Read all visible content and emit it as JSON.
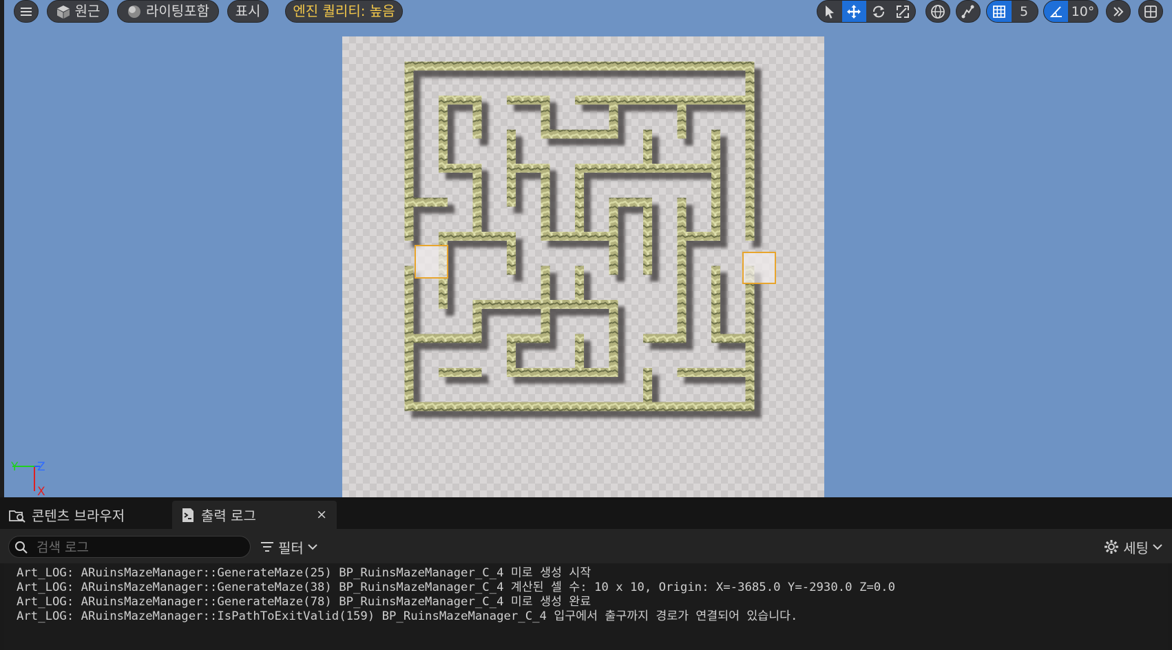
{
  "viewport": {
    "menu_icon": "hamburger-icon",
    "perspective_label": "원근",
    "perspective_icon": "cube-icon",
    "lighting_label": "라이팅포함",
    "lighting_icon": "sphere-icon",
    "show_label": "표시",
    "quality_label": "엔진 퀄리티: 높음",
    "grid_snap_value": "5",
    "rotation_snap_value": "10°",
    "accent_color": "#1e6fd8",
    "warning_color": "#f2c74a",
    "maze": {
      "rows": 10,
      "cols": 10,
      "entrance_row": 5,
      "exit_row": 5,
      "marker_color": "#e8a52c"
    },
    "gizmo": {
      "y_label": "Y",
      "z_label": "Z",
      "x_label": "X"
    }
  },
  "panel": {
    "tabs": [
      {
        "label": "콘텐츠 브라우저",
        "icon": "folder-search-icon"
      },
      {
        "label": "출력 로그",
        "icon": "output-log-icon",
        "close": "×"
      }
    ],
    "search_placeholder": "검색 로그",
    "filter_label": "필터",
    "settings_label": "세팅",
    "log_lines": [
      "Art_LOG: ARuinsMazeManager::GenerateMaze(25) BP_RuinsMazeManager_C_4 미로 생성 시작",
      "Art_LOG: ARuinsMazeManager::GenerateMaze(38) BP_RuinsMazeManager_C_4 계산된 셀 수: 10 x 10, Origin: X=-3685.0 Y=-2930.0 Z=0.0",
      "Art_LOG: ARuinsMazeManager::GenerateMaze(78) BP_RuinsMazeManager_C_4 미로 생성 완료",
      "Art_LOG: ARuinsMazeManager::IsPathToExitValid(159) BP_RuinsMazeManager_C_4 입구에서 출구까지 경로가 연결되어 있습니다."
    ]
  }
}
